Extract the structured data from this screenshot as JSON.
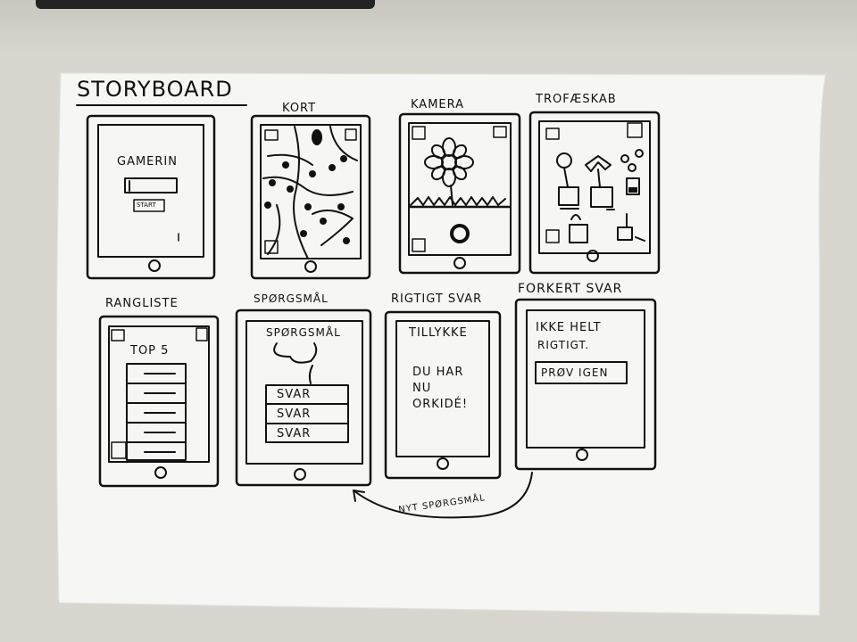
{
  "title": "STORYBOARD",
  "screens": [
    {
      "label": "KORT"
    },
    {
      "label": "KAMERA"
    },
    {
      "label": "TROFÆSKAB"
    },
    {
      "label": "RANGLISTE"
    },
    {
      "label": "SPØRGSMÅL"
    },
    {
      "label": "RIGTIGT SVAR"
    },
    {
      "label": "FORKERT SVAR"
    }
  ],
  "login": {
    "app_name": "GAMERIN",
    "start_button": "START"
  },
  "rangliste": {
    "heading": "TOP 5"
  },
  "question": {
    "title": "SPØRGSMÅL",
    "answers": [
      "SVAR",
      "SVAR",
      "SVAR"
    ]
  },
  "correct": {
    "line1": "TILLYKKE",
    "line2": "DU HAR",
    "line3": "NU",
    "line4": "ORKIDÉ!"
  },
  "wrong": {
    "line1": "IKKE HELT",
    "line2": "RIGTIGT.",
    "retry_button": "PRØV IGEN"
  },
  "arrow_label": "NYT SPØRGSMÅL",
  "colors": {
    "paper": "#f6f6f4",
    "ink": "#111111",
    "background": "#d9d6cf"
  }
}
